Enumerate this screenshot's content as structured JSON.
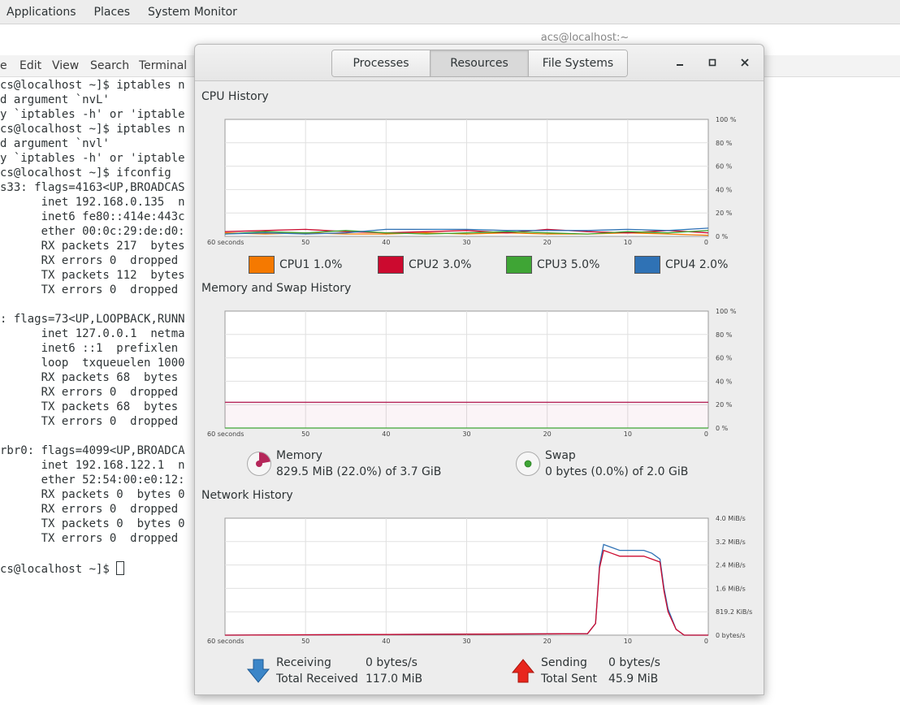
{
  "top_panel": {
    "applications": "Applications",
    "places": "Places",
    "system_monitor": "System Monitor"
  },
  "terminal": {
    "title": "acs@localhost:~",
    "menu": [
      "e",
      "Edit",
      "View",
      "Search",
      "Terminal"
    ],
    "lines": [
      "cs@localhost ~]$ iptables n",
      "d argument `nvL'",
      "y `iptables -h' or 'iptable",
      "cs@localhost ~]$ iptables n",
      "d argument `nvl'",
      "y `iptables -h' or 'iptable",
      "cs@localhost ~]$ ifconfig",
      "s33: flags=4163<UP,BROADCAS",
      "      inet 192.168.0.135  n",
      "      inet6 fe80::414e:443c",
      "      ether 00:0c:29:de:d0:",
      "      RX packets 217  bytes",
      "      RX errors 0  dropped",
      "      TX packets 112  bytes",
      "      TX errors 0  dropped",
      "",
      ": flags=73<UP,LOOPBACK,RUNN",
      "      inet 127.0.0.1  netma",
      "      inet6 ::1  prefixlen",
      "      loop  txqueuelen 1000",
      "      RX packets 68  bytes",
      "      RX errors 0  dropped",
      "      TX packets 68  bytes",
      "      TX errors 0  dropped",
      "",
      "rbr0: flags=4099<UP,BROADCA",
      "      inet 192.168.122.1  n",
      "      ether 52:54:00:e0:12:",
      "      RX packets 0  bytes 0",
      "      RX errors 0  dropped",
      "      TX packets 0  bytes 0",
      "      TX errors 0  dropped",
      "",
      "cs@localhost ~]$ "
    ]
  },
  "sysmon": {
    "tabs": [
      "Processes",
      "Resources",
      "File Systems"
    ],
    "active_tab": 1,
    "cpu": {
      "title": "CPU History",
      "y_ticks": [
        "100 %",
        "80 %",
        "60 %",
        "40 %",
        "20 %",
        "0 %"
      ],
      "x_ticks": [
        "60 seconds",
        "50",
        "40",
        "30",
        "20",
        "10",
        "0"
      ],
      "legend": [
        {
          "name": "CPU1",
          "value": "1.0%",
          "color": "#f57900"
        },
        {
          "name": "CPU2",
          "value": "3.0%",
          "color": "#cc0a2f"
        },
        {
          "name": "CPU3",
          "value": "5.0%",
          "color": "#3fa535"
        },
        {
          "name": "CPU4",
          "value": "2.0%",
          "color": "#2f72b5"
        }
      ]
    },
    "memory": {
      "title": "Memory and Swap History",
      "y_ticks": [
        "100 %",
        "80 %",
        "60 %",
        "40 %",
        "20 %",
        "0 %"
      ],
      "x_ticks": [
        "60 seconds",
        "50",
        "40",
        "30",
        "20",
        "10",
        "0"
      ],
      "memory_label": "Memory",
      "memory_value": "829.5 MiB (22.0%) of 3.7 GiB",
      "swap_label": "Swap",
      "swap_value": "0 bytes (0.0%) of 2.0 GiB",
      "memory_color": "#b5275a",
      "swap_color": "#3fa535"
    },
    "network": {
      "title": "Network History",
      "y_ticks": [
        "4.0 MiB/s",
        "3.2 MiB/s",
        "2.4 MiB/s",
        "1.6 MiB/s",
        "819.2 KiB/s",
        "0 bytes/s"
      ],
      "x_ticks": [
        "60 seconds",
        "50",
        "40",
        "30",
        "20",
        "10",
        "0"
      ],
      "receiving_label": "Receiving",
      "receiving_value": "0 bytes/s",
      "total_received_label": "Total Received",
      "total_received_value": "117.0 MiB",
      "sending_label": "Sending",
      "sending_value": "0 bytes/s",
      "total_sent_label": "Total Sent",
      "total_sent_value": "45.9 MiB",
      "receive_color": "#2f72b5",
      "send_color": "#cc0a2f"
    }
  },
  "chart_data": [
    {
      "type": "line",
      "title": "CPU History",
      "xlabel": "",
      "ylabel": "",
      "x": [
        60,
        55,
        50,
        45,
        40,
        35,
        30,
        25,
        20,
        15,
        10,
        5,
        0
      ],
      "xlim": [
        60,
        0
      ],
      "ylim": [
        0,
        100
      ],
      "series": [
        {
          "name": "CPU1",
          "values": [
            3,
            2,
            3,
            2,
            2,
            3,
            2,
            3,
            2,
            2,
            3,
            2,
            1
          ]
        },
        {
          "name": "CPU2",
          "values": [
            4,
            5,
            6,
            4,
            3,
            4,
            5,
            3,
            6,
            4,
            3,
            5,
            3
          ]
        },
        {
          "name": "CPU3",
          "values": [
            2,
            4,
            3,
            5,
            3,
            2,
            3,
            4,
            3,
            2,
            4,
            3,
            5
          ]
        },
        {
          "name": "CPU4",
          "values": [
            2,
            3,
            2,
            3,
            6,
            6,
            6,
            5,
            5,
            5,
            6,
            5,
            7
          ]
        }
      ]
    },
    {
      "type": "line",
      "title": "Memory and Swap History",
      "xlabel": "",
      "ylabel": "",
      "x": [
        60,
        0
      ],
      "xlim": [
        60,
        0
      ],
      "ylim": [
        0,
        100
      ],
      "series": [
        {
          "name": "Memory",
          "values": [
            22,
            22
          ]
        },
        {
          "name": "Swap",
          "values": [
            0,
            0
          ]
        }
      ]
    },
    {
      "type": "line",
      "title": "Network History",
      "xlabel": "",
      "ylabel": "",
      "x": [
        60,
        15,
        14,
        13.5,
        13,
        12,
        11,
        10,
        9,
        8,
        7,
        6,
        5.5,
        5,
        4,
        3,
        2.5,
        2,
        0
      ],
      "xlim": [
        60,
        0
      ],
      "ylim": [
        0,
        4.0
      ],
      "y_unit": "MiB/s",
      "series": [
        {
          "name": "Receiving",
          "values": [
            0,
            0.05,
            0.4,
            2.4,
            3.1,
            3.0,
            2.9,
            2.9,
            2.9,
            2.9,
            2.8,
            2.6,
            1.6,
            0.9,
            0.2,
            0,
            0,
            0,
            0
          ]
        },
        {
          "name": "Sending",
          "values": [
            0,
            0.05,
            0.4,
            2.3,
            2.9,
            2.8,
            2.7,
            2.7,
            2.7,
            2.7,
            2.6,
            2.5,
            1.5,
            0.8,
            0.2,
            0,
            0,
            0,
            0
          ]
        }
      ]
    }
  ]
}
